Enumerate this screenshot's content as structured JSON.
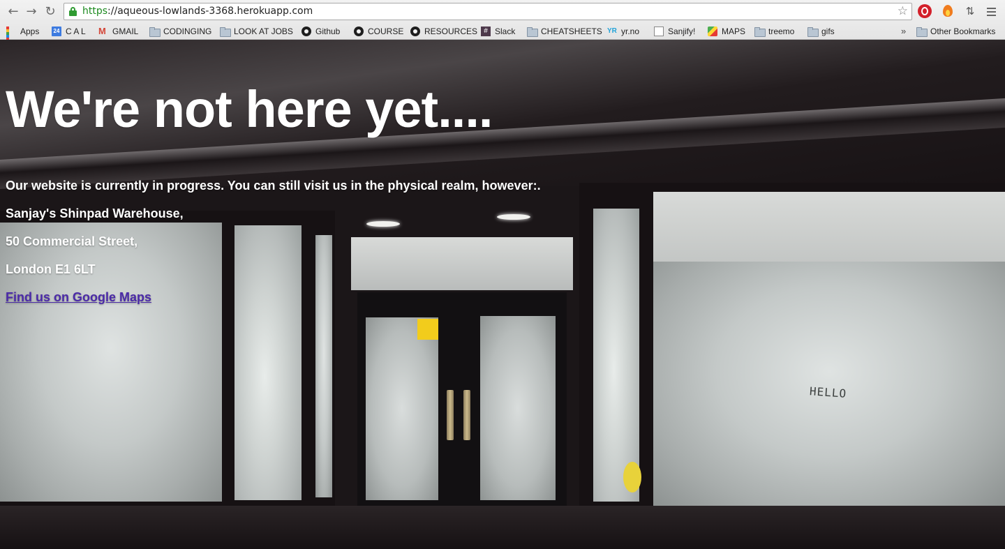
{
  "browser": {
    "url_scheme": "https",
    "url_rest": "://aqueous-lowlands-3368.herokuapp.com",
    "back_icon": "back-arrow-icon",
    "forward_icon": "forward-arrow-icon",
    "reload_icon": "reload-icon",
    "bookmarks": [
      {
        "label": "Apps",
        "icon": "apps-grid-icon"
      },
      {
        "label": "C A L",
        "icon": "calendar-icon",
        "icon_text": "24"
      },
      {
        "label": "GMAIL",
        "icon": "gmail-icon",
        "icon_text": "M"
      },
      {
        "label": "CODINGING",
        "icon": "folder-icon"
      },
      {
        "label": "LOOK AT JOBS",
        "icon": "folder-icon"
      },
      {
        "label": "Github",
        "icon": "github-icon"
      },
      {
        "label": "COURSE",
        "icon": "github-icon"
      },
      {
        "label": "RESOURCES",
        "icon": "github-icon"
      },
      {
        "label": "Slack",
        "icon": "slack-icon",
        "icon_text": "#"
      },
      {
        "label": "CHEATSHEETS",
        "icon": "folder-icon"
      },
      {
        "label": "yr.no",
        "icon": "yr-icon",
        "icon_text": "YR"
      },
      {
        "label": "Sanjify!",
        "icon": "page-icon"
      },
      {
        "label": "MAPS",
        "icon": "maps-icon"
      },
      {
        "label": "treemo",
        "icon": "folder-icon"
      },
      {
        "label": "gifs",
        "icon": "folder-icon"
      }
    ],
    "overflow": "»",
    "other_bookmarks": "Other Bookmarks"
  },
  "page": {
    "headline": "We're not here yet....",
    "intro": "Our website is currently in progress. You can still visit us in the physical realm, however:.",
    "address": [
      "Sanjay's Shinpad Warehouse,",
      "50 Commercial Street,",
      "London E1 6LT"
    ],
    "maps_link": "Find us on Google Maps",
    "window_graffiti": "HELLO"
  },
  "colors": {
    "link": "#4b2aa8",
    "secure_green": "#2f9b32",
    "text": "#ffffff"
  }
}
